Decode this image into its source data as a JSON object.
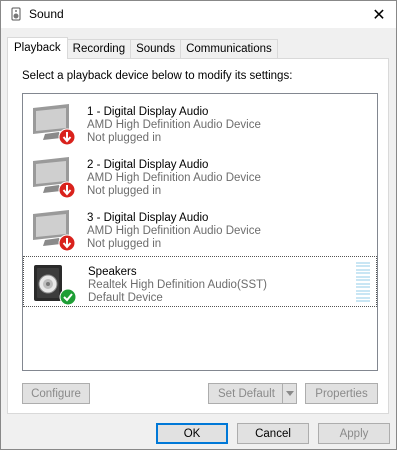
{
  "window": {
    "title": "Sound",
    "close_glyph": "✕"
  },
  "tabs": [
    {
      "label": "Playback",
      "active": true
    },
    {
      "label": "Recording",
      "active": false
    },
    {
      "label": "Sounds",
      "active": false
    },
    {
      "label": "Communications",
      "active": false
    }
  ],
  "playback": {
    "instruction": "Select a playback device below to modify its settings:",
    "devices": [
      {
        "name": "1 - Digital Display Audio",
        "description": "AMD High Definition Audio Device",
        "status": "Not plugged in",
        "icon": "monitor-icon",
        "badge": "red-down-arrow-badge"
      },
      {
        "name": "2 - Digital Display Audio",
        "description": "AMD High Definition Audio Device",
        "status": "Not plugged in",
        "icon": "monitor-icon",
        "badge": "red-down-arrow-badge"
      },
      {
        "name": "3 - Digital Display Audio",
        "description": "AMD High Definition Audio Device",
        "status": "Not plugged in",
        "icon": "monitor-icon",
        "badge": "red-down-arrow-badge"
      },
      {
        "name": "Speakers",
        "description": "Realtek High Definition Audio(SST)",
        "status": "Default Device",
        "icon": "speaker-icon",
        "badge": "green-check-badge",
        "selected": true
      }
    ],
    "buttons": {
      "configure": "Configure",
      "set_default": "Set Default",
      "properties": "Properties"
    }
  },
  "dialog_buttons": {
    "ok": "OK",
    "cancel": "Cancel",
    "apply": "Apply"
  },
  "colors": {
    "accent": "#0078d7",
    "error_badge": "#d9221c",
    "ok_badge": "#1e9e35",
    "level_meter": "#c9e6f4"
  }
}
